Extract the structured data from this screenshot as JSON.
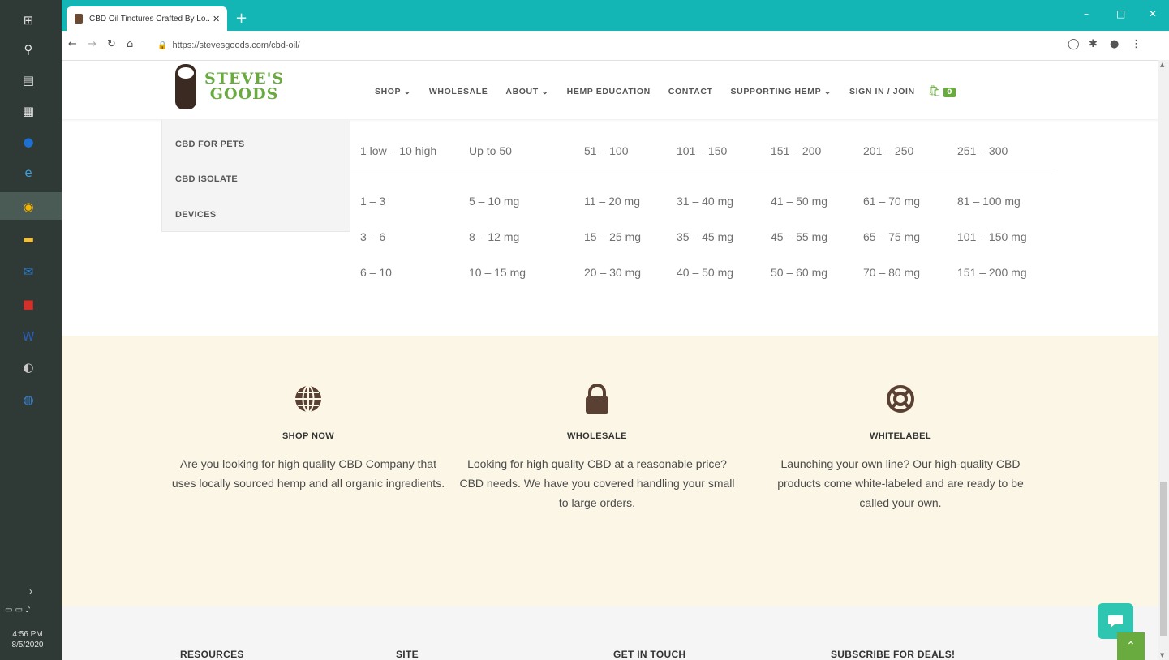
{
  "taskbar": {
    "time": "4:56 PM",
    "date": "8/5/2020"
  },
  "browser": {
    "tab_title": "CBD Oil Tinctures Crafted By Lo...",
    "url": "https://stevesgoods.com/cbd-oil/"
  },
  "site": {
    "logo_line1": "STEVE'S",
    "logo_line2": "GOODS",
    "nav": [
      {
        "label": "SHOP",
        "caret": "⌄"
      },
      {
        "label": "WHOLESALE",
        "caret": ""
      },
      {
        "label": "ABOUT",
        "caret": "⌄"
      },
      {
        "label": "HEMP EDUCATION",
        "caret": ""
      },
      {
        "label": "CONTACT",
        "caret": ""
      },
      {
        "label": "SUPPORTING HEMP",
        "caret": "⌄"
      },
      {
        "label": "SIGN IN / JOIN",
        "caret": ""
      }
    ],
    "cart_count": "0"
  },
  "dropdown": {
    "items": [
      "CBD FOR PETS",
      "CBD ISOLATE",
      "DEVICES"
    ]
  },
  "dosage_table": {
    "rows": [
      [
        "1 low – 10 high",
        "Up to 50",
        "51 – 100",
        "101 – 150",
        "151 – 200",
        "201 – 250",
        "251 – 300"
      ],
      [
        "1 – 3",
        "5 – 10 mg",
        "11 – 20 mg",
        "31 – 40 mg",
        "41 – 50 mg",
        "61 – 70 mg",
        "81 – 100 mg"
      ],
      [
        "3 – 6",
        "8 – 12 mg",
        "15 – 25 mg",
        "35 – 45 mg",
        "45 – 55 mg",
        "65 – 75 mg",
        "101 – 150 mg"
      ],
      [
        "6 – 10",
        "10 – 15 mg",
        "20 – 30 mg",
        "40 – 50 mg",
        "50 – 60 mg",
        "70 – 80 mg",
        "151 – 200 mg"
      ]
    ]
  },
  "features": [
    {
      "icon": "globe-icon",
      "heading": "SHOP NOW",
      "text": "Are you looking for high quality CBD Company that uses locally sourced hemp and all organic ingredients."
    },
    {
      "icon": "lock-icon",
      "heading": "WHOLESALE",
      "text": "Looking for high quality CBD at a reasonable price? CBD needs. We have you covered handling your small to large orders."
    },
    {
      "icon": "lifebuoy-icon",
      "heading": "WHITELABEL",
      "text": "Launching your own line? Our high-quality CBD products come white-labeled and are ready to be called your own."
    }
  ],
  "footer": {
    "headings": [
      "RESOURCES",
      "SITE",
      "GET IN TOUCH",
      "SUBSCRIBE FOR DEALS!"
    ]
  },
  "colors": {
    "brand_green": "#6aab3f",
    "brand_brown": "#5a4032",
    "tab_bar": "#13b5b5",
    "feature_bg": "#fbf6e5",
    "chat_button": "#2ec6b0"
  }
}
